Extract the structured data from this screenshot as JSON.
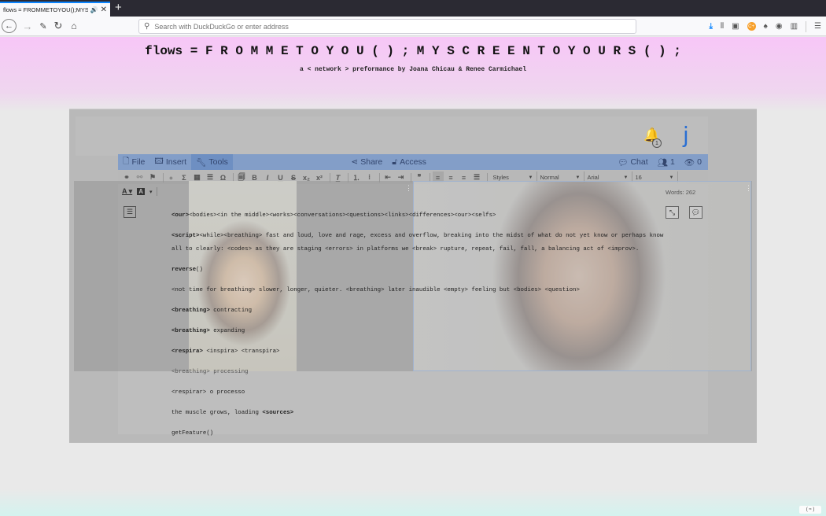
{
  "browser": {
    "tab_title": "flows = FROMMETOYOU();MYSC",
    "tab_audio_icon": "speaker-icon",
    "tab_close_icon": "close-icon",
    "new_tab_label": "+",
    "nav": {
      "back": "←",
      "forward": "→",
      "tools": "✎",
      "reload": "↻",
      "home": "⌂"
    },
    "url_placeholder": "Search with DuckDuckGo or enter address",
    "url_value": "",
    "toolbar_icons": [
      "download-icon",
      "library-icon",
      "sidebar-icon",
      "extension-cplus-icon",
      "extension-icon",
      "account-icon",
      "extensions-grid-icon",
      "menu-icon"
    ]
  },
  "page": {
    "title": "flows = F R O M M E T O Y O U ( ) ; M Y S C R E E N T O Y O U R S ( ) ;",
    "subtitle": "a < network > preformance by Joana Chicau & Renee Carmichael",
    "notifications_count": "1",
    "user_initial": "j",
    "bottom_button": "( ≈ )"
  },
  "editor": {
    "menu": {
      "file": "File",
      "insert": "Insert",
      "tools": "Tools",
      "share": "Share",
      "access": "Access",
      "chat": "Chat",
      "users_count": "1",
      "viewers_count": "0"
    },
    "toolbar": {
      "styles": "Styles",
      "format": "Normal",
      "font": "Arial",
      "size": "16"
    },
    "word_count": "Words: 262",
    "lines": [
      {
        "bold": "<our>",
        "rest": "<bodies><in the middle><works><conversations><questions><links><differences><our><selfs>"
      },
      {
        "bold": "<script>",
        "rest": "<while><breathing> fast and loud, love and rage, excess and overflow, breaking into the midst of what do not yet know or perhaps know"
      },
      {
        "bold": "",
        "rest": "all to clearly: <codes> as they are staging <errors> in platforms we <break> rupture, repeat, fail, fall, a balancing act of <improv>."
      },
      {
        "bold": "reverse",
        "rest": "()"
      },
      {
        "bold": "",
        "rest": "<not time for breathing> slower, longer, quieter. <breathing> later inaudible <empty> feeling but <bodies> <question>"
      },
      {
        "bold": "<breathing>",
        "rest": " contracting"
      },
      {
        "bold": "<breathing>",
        "rest": " expanding"
      },
      {
        "bold": "<respira>",
        "rest": " <inspira> <transpira>"
      },
      {
        "bold": "",
        "rest": "<breathing> processing",
        "muted": true
      },
      {
        "bold": "",
        "rest": "<respirar> o processo"
      },
      {
        "bold": "",
        "rest": "the muscle grows, loading ",
        "tail_bold": "<sources>"
      },
      {
        "bold": "",
        "rest": "getFeature()"
      }
    ]
  },
  "colors": {
    "menubar": "#839ec8",
    "accent_blue": "#2a6fd3",
    "header_pink": "#f7c6f7"
  }
}
